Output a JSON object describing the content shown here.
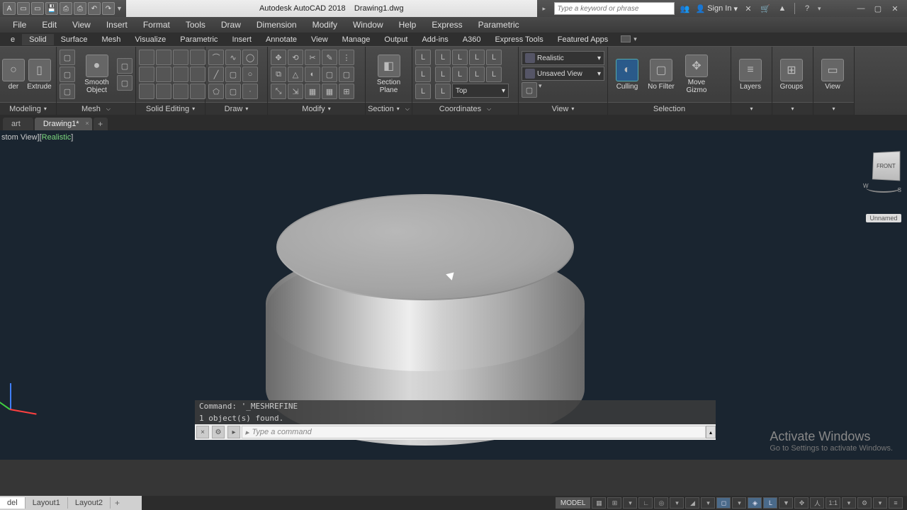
{
  "title": {
    "app": "Autodesk AutoCAD 2018",
    "file": "Drawing1.dwg",
    "search_placeholder": "Type a keyword or phrase",
    "signin": "Sign In"
  },
  "menus": [
    "File",
    "Edit",
    "View",
    "Insert",
    "Format",
    "Tools",
    "Draw",
    "Dimension",
    "Modify",
    "Window",
    "Help",
    "Express",
    "Parametric"
  ],
  "ribbon_tabs": [
    "Solid",
    "Surface",
    "Mesh",
    "Visualize",
    "Parametric",
    "Insert",
    "Annotate",
    "View",
    "Manage",
    "Output",
    "Add-ins",
    "A360",
    "Express Tools",
    "Featured Apps"
  ],
  "panels": {
    "modeling": {
      "title": "Modeling",
      "btn1": "der",
      "btn2": "Extrude"
    },
    "mesh": {
      "title": "Mesh",
      "btn": "Smooth Object"
    },
    "solid_editing": {
      "title": "Solid Editing"
    },
    "draw": {
      "title": "Draw"
    },
    "modify": {
      "title": "Modify"
    },
    "section": {
      "title": "Section",
      "btn": "Section Plane"
    },
    "coordinates": {
      "title": "Coordinates",
      "visual_style": "Realistic",
      "view": "Unsaved View",
      "ortho": "Top"
    },
    "view": {
      "title": "View"
    },
    "selection": {
      "title": "Selection",
      "culling": "Culling",
      "filter": "No Filter",
      "gizmo": "Move Gizmo"
    },
    "layers": {
      "title": "Layers"
    },
    "groups": {
      "title": "Groups"
    },
    "view2": {
      "title": "View"
    }
  },
  "doctabs": {
    "start": "art",
    "drawing": "Drawing1*"
  },
  "viewport": {
    "label_prefix": "stom View][",
    "label_style": "Realistic",
    "label_suffix": "]",
    "viewcube_face": "FRONT",
    "viewcube_state": "Unnamed"
  },
  "command": {
    "hist1": "Command: '_MESHREFINE",
    "hist2": "1 object(s) found.",
    "placeholder": "Type a command"
  },
  "layout_tabs": [
    "del",
    "Layout1",
    "Layout2"
  ],
  "status": {
    "model": "MODEL",
    "scale": "1:1"
  },
  "watermark": {
    "line1": "Activate Windows",
    "line2": "Go to Settings to activate Windows."
  }
}
